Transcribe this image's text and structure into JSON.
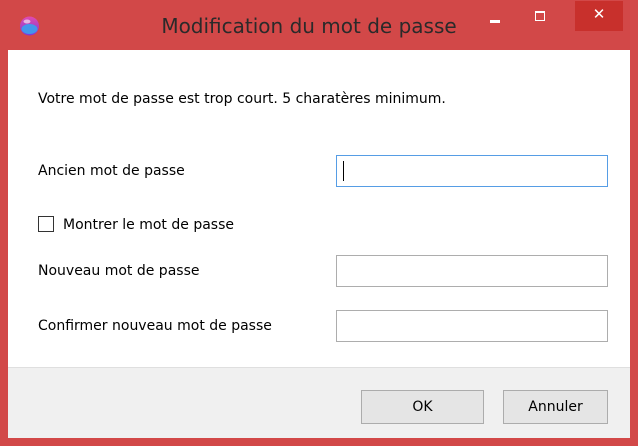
{
  "window": {
    "title": "Modification du mot de passe",
    "accent_color": "#d24848",
    "close_color": "#c8302c",
    "icons": {
      "app": "app-icon",
      "minimize": "minimize-icon",
      "maximize": "maximize-icon",
      "close": "close-icon"
    },
    "close_glyph": "✕"
  },
  "message": "Votre mot de passe est trop court. 5 charatères minimum.",
  "form": {
    "old_password": {
      "label": "Ancien mot de passe",
      "value": "",
      "focused": true
    },
    "show_password": {
      "label": "Montrer le mot de passe",
      "checked": false
    },
    "new_password": {
      "label": "Nouveau mot de passe",
      "value": ""
    },
    "confirm_password": {
      "label": "Confirmer nouveau mot de passe",
      "value": ""
    }
  },
  "buttons": {
    "ok": "OK",
    "cancel": "Annuler"
  }
}
